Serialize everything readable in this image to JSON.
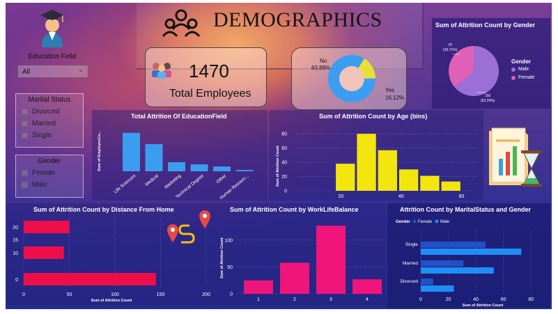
{
  "header": {
    "title": "DEMOGRAPHICS"
  },
  "slicers": {
    "education": {
      "title": "Education Feild",
      "selected": "All"
    },
    "marital": {
      "title": "Marital Status",
      "options": [
        "Divorced",
        "Married",
        "Single"
      ]
    },
    "gender": {
      "title": "Gender",
      "options": [
        "Female",
        "Male"
      ]
    }
  },
  "kpi": {
    "value": "1470",
    "label": "Total Employees"
  },
  "attrition_donut": {
    "no_label": "No",
    "no_pct": "83.88%",
    "yes_label": "Yes",
    "yes_pct": "16.12%",
    "colors": {
      "no": "#3b9df0",
      "yes": "#e8e034"
    }
  },
  "gender_pie": {
    "title": "Sum of Attrition Count by Gender",
    "legend_title": "Gender",
    "legend": [
      "Male",
      "Female"
    ],
    "female_value": "87",
    "female_pct": "(36.71%)",
    "male_value": "150",
    "male_pct": "(63.29%)",
    "colors": {
      "male": "#9b6fd6",
      "female": "#e05fb8"
    }
  },
  "chart_data": [
    {
      "id": "edu",
      "type": "bar",
      "title": "Total Attrition Of EducationField",
      "ylabel": "Sum of EmployeeCo...",
      "categories": [
        "Life Sciences",
        "Medical",
        "Marketing",
        "Technical Degree",
        "Other",
        "Human Resourc..."
      ],
      "values": [
        89,
        63,
        21,
        16,
        11,
        3
      ],
      "color": "#3b9df0"
    },
    {
      "id": "age",
      "type": "bar",
      "title": "Sum of Attrition Count by Age (bins)",
      "ylabel": "Sum of Attrition Count",
      "x": [
        18,
        25,
        32,
        39,
        46,
        53
      ],
      "values": [
        38,
        80,
        57,
        30,
        21,
        13
      ],
      "xticks": [
        "20",
        "40",
        "60"
      ],
      "yticks": [
        "0",
        "20",
        "40",
        "60",
        "80"
      ],
      "color": "#f2e60e"
    },
    {
      "id": "distance",
      "type": "bar",
      "orientation": "horizontal",
      "title": "Sum of Attrition Count by Distance From Home",
      "xlabel": "Sum of Attrition Count",
      "categories": [
        "20",
        "10",
        "15",
        "0"
      ],
      "values": [
        50,
        44,
        null,
        145
      ],
      "yticks": [
        "20",
        "15",
        "10",
        "0"
      ],
      "xticks": [
        "0",
        "50",
        "100",
        "150",
        "200"
      ],
      "color": "#ee0f4a"
    },
    {
      "id": "wlb",
      "type": "bar",
      "title": "Sum of Attrition Count by WorkLifeBalance",
      "ylabel": "Sum of Attrition Count",
      "categories": [
        "1",
        "2",
        "3",
        "4"
      ],
      "values": [
        25,
        58,
        127,
        27
      ],
      "yticks": [
        "0",
        "50",
        "100"
      ],
      "color": "#f0157a"
    },
    {
      "id": "marital",
      "type": "bar",
      "orientation": "horizontal",
      "title": "Attrition Count by MaritalStatus and Gender",
      "xlabel": "Sum of Attrition Count",
      "legend_title": "Gender",
      "categories": [
        "Single",
        "Married",
        "Divorced"
      ],
      "series": [
        {
          "name": "Female",
          "values": [
            47,
            31,
            9
          ],
          "color": "#2250c8"
        },
        {
          "name": "Male",
          "values": [
            73,
            53,
            24
          ],
          "color": "#1f8ef5"
        }
      ],
      "xticks": [
        "0",
        "20",
        "40",
        "60",
        "80"
      ]
    }
  ]
}
